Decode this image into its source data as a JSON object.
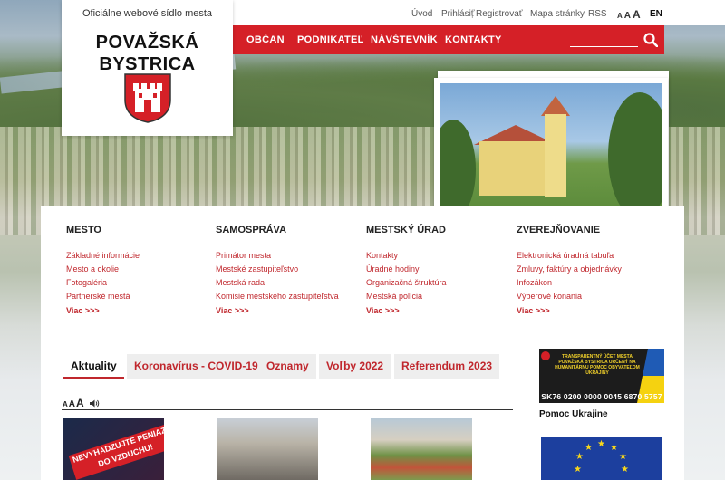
{
  "logo": {
    "tagline": "Oficiálne webové sídlo mesta",
    "title_line1": "POVAŽSKÁ",
    "title_line2": "BYSTRICA"
  },
  "topbar": {
    "home": "Úvod",
    "login": "Prihlásiť",
    "separator": "|",
    "register": "Registrovať",
    "sitemap": "Mapa stránky",
    "rss": "RSS",
    "font_small": "A",
    "font_medium": "A",
    "font_large": "A",
    "language": "EN"
  },
  "nav": {
    "items": [
      "OBČAN",
      "PODNIKATEĽ",
      "NÁVŠTEVNÍK",
      "KONTAKTY"
    ],
    "search_placeholder": ""
  },
  "menu": {
    "columns": [
      {
        "heading": "MESTO",
        "links": [
          "Základné informácie",
          "Mesto a okolie",
          "Fotogaléria",
          "Partnerské mestá"
        ],
        "more": "Viac >>>"
      },
      {
        "heading": "SAMOSPRÁVA",
        "links": [
          "Primátor mesta",
          "Mestské zastupiteľstvo",
          "Mestská rada",
          "Komisie mestského zastupiteľstva"
        ],
        "more": "Viac >>>"
      },
      {
        "heading": "MESTSKÝ ÚRAD",
        "links": [
          "Kontakty",
          "Úradné hodiny",
          "Organizačná štruktúra",
          "Mestská polícia"
        ],
        "more": "Viac >>>"
      },
      {
        "heading": "ZVEREJŇOVANIE",
        "links": [
          "Elektronická úradná tabuľa",
          "Zmluvy, faktúry a objednávky",
          "Infozákon",
          "Výberové konania"
        ],
        "more": "Viac >>>"
      }
    ]
  },
  "tabs": [
    "Aktuality",
    "Koronavírus - COVID-19",
    "Oznamy",
    "Voľby 2022",
    "Referendum 2023"
  ],
  "font_controls": {
    "small": "A",
    "medium": "A",
    "large": "A"
  },
  "news": {
    "thumb1_text": "NEVYHADZUJTE PENIAZE DO VZDUCHU!"
  },
  "sidebar": {
    "ua_banner_text": "TRANSPARENTNÝ ÚČET MESTA POVAŽSKÁ BYSTRICA URČENÝ NA HUMANITÁRNU POMOC OBYVATEĽOM UKRAJINY",
    "ua_iban": "SK76 0200 0000 0045 6870 5757",
    "ua_caption": "Pomoc Ukrajine"
  },
  "colors": {
    "brand_red": "#d52027",
    "link_red": "#c0272d",
    "eu_blue": "#1c3f9e",
    "eu_star": "#f6d61d"
  }
}
